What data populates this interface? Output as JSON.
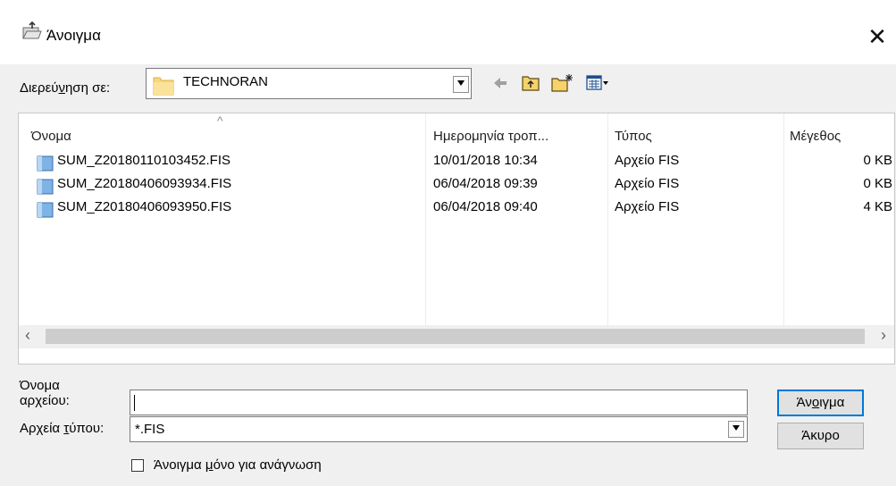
{
  "window": {
    "title": "Άνοιγμα",
    "close_glyph": "✕",
    "icon": "open-file-icon"
  },
  "look_in": {
    "label_pre": "Διερεύ",
    "label_key": "ν",
    "label_post": "ηση σε:",
    "value": "TECHNORAN",
    "icon": "folder-icon"
  },
  "toolbar": {
    "back_icon": "back-arrow-icon",
    "up_icon": "up-folder-icon",
    "new_folder_icon": "new-folder-icon",
    "view_menu_icon": "view-menu-icon"
  },
  "file_list": {
    "sort_glyph": "^",
    "columns": [
      "Όνομα",
      "Ημερομηνία τροπ...",
      "Τύπος",
      "Μέγεθος"
    ],
    "rows": [
      {
        "name": "SUM_Z20180110103452.FIS",
        "date": "10/01/2018 10:34",
        "type": "Αρχείο FIS",
        "size": "0 KB"
      },
      {
        "name": "SUM_Z20180406093934.FIS",
        "date": "06/04/2018 09:39",
        "type": "Αρχείο FIS",
        "size": "0 KB"
      },
      {
        "name": "SUM_Z20180406093950.FIS",
        "date": "06/04/2018 09:40",
        "type": "Αρχείο FIS",
        "size": "4 KB"
      }
    ],
    "scroll_left_glyph": "‹",
    "scroll_right_glyph": "›"
  },
  "file_name": {
    "label_line1": "Όνομα",
    "label_line2_pre": "αρ",
    "label_line2_key": "χ",
    "label_line2_post": "είου:",
    "value": ""
  },
  "file_type": {
    "label_pre": "Αρχεία ",
    "label_key": "τ",
    "label_post": "ύπου:",
    "value": "*.FIS"
  },
  "buttons": {
    "open_pre": "Άν",
    "open_key": "ο",
    "open_post": "ιγμα",
    "cancel": "Άκυρο"
  },
  "readonly": {
    "label_pre": "Άνοιγμα ",
    "label_key": "μ",
    "label_post": "όνο για ανάγνωση",
    "checked": false
  },
  "colors": {
    "accent": "#0078d7",
    "folder": "#f8d775",
    "dialog_bg": "#f0f0f0"
  }
}
